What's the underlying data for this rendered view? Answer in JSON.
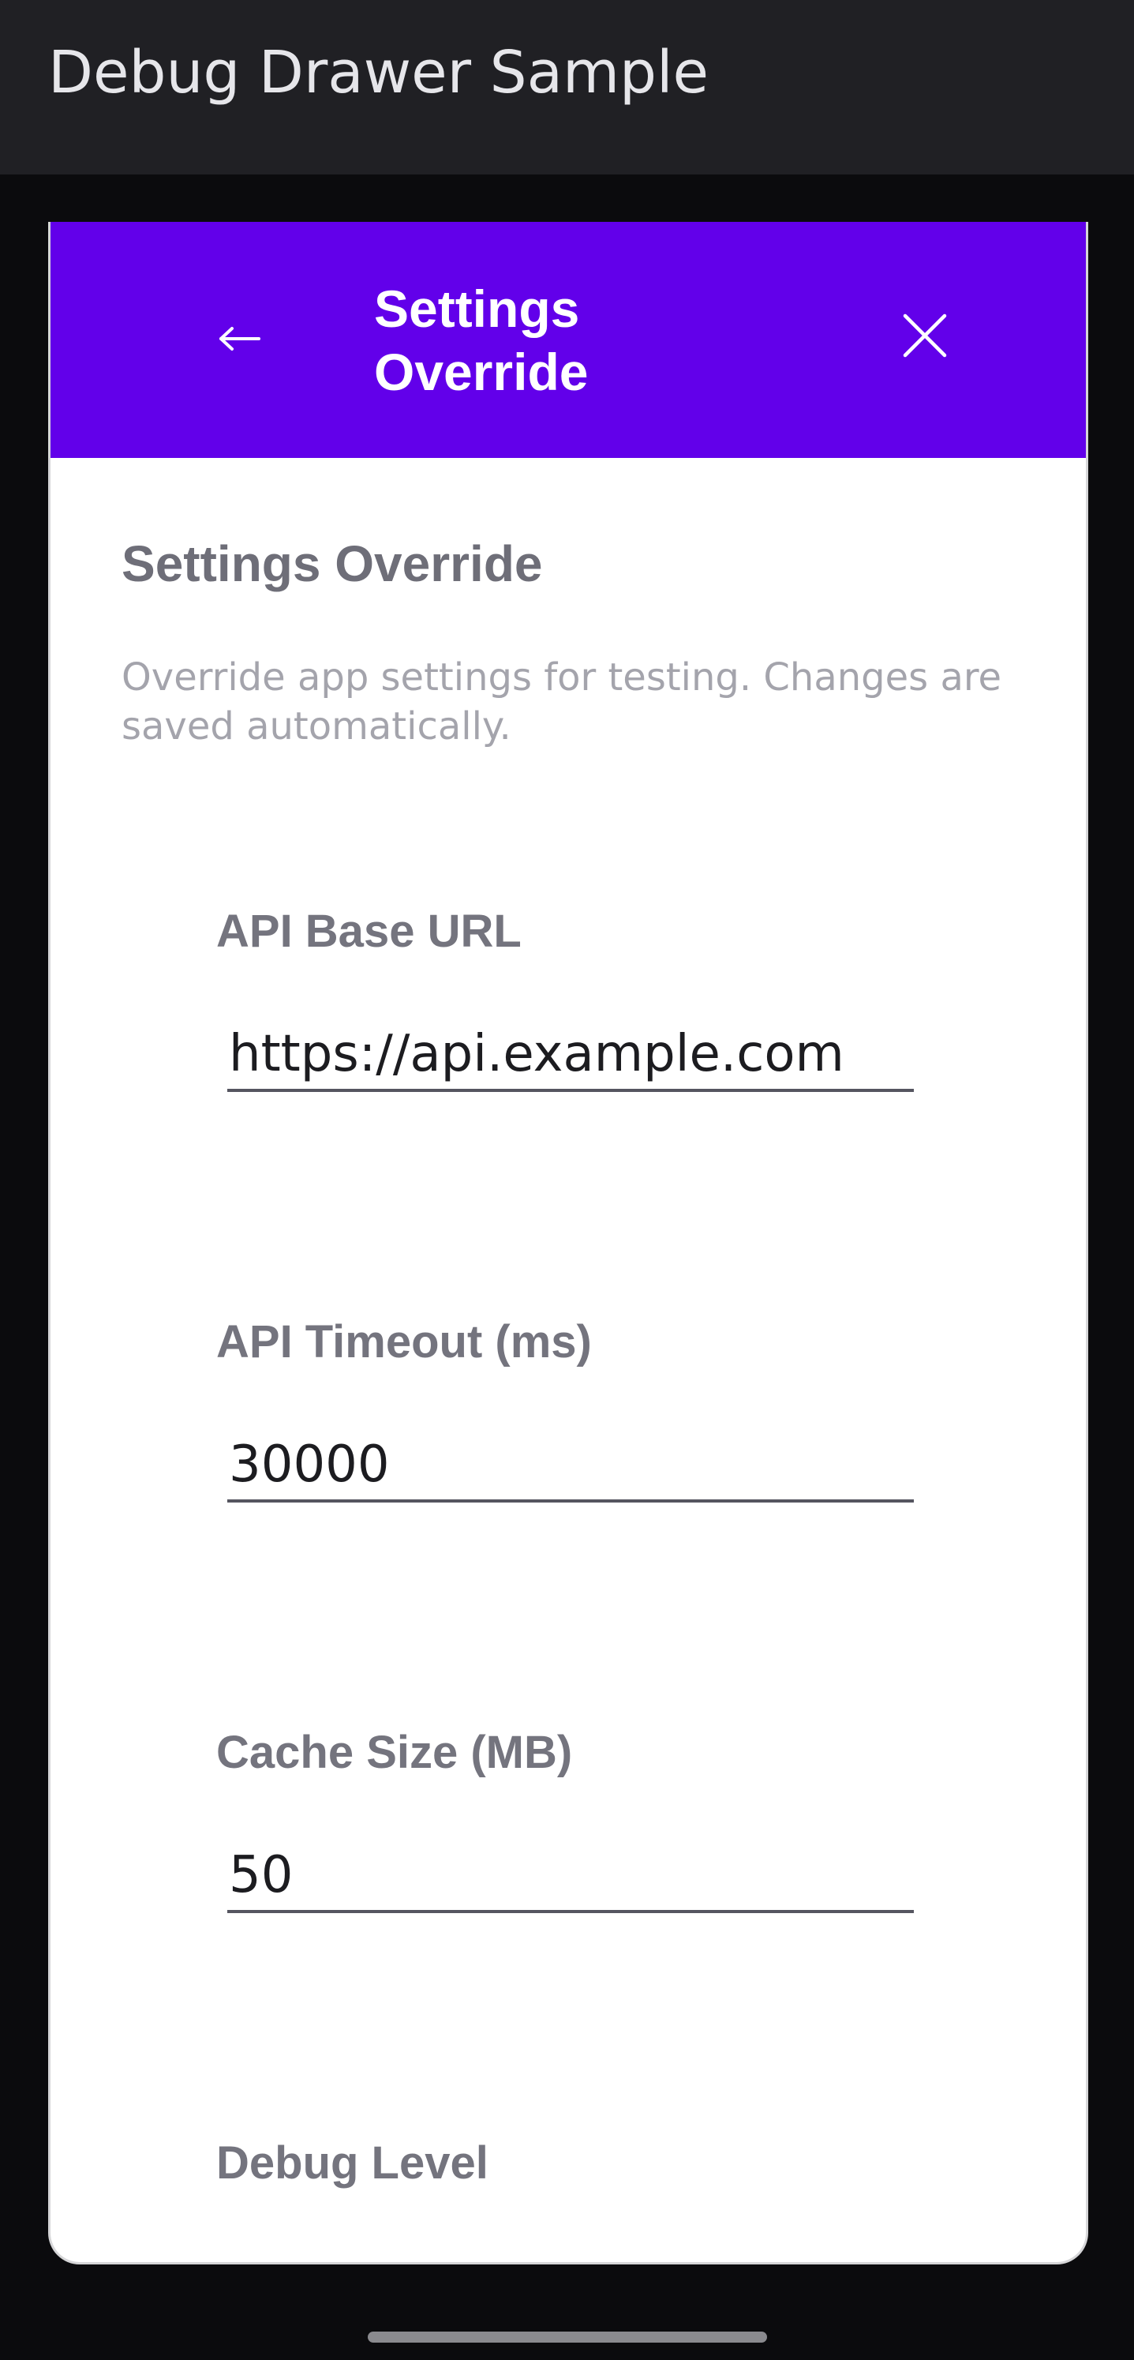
{
  "app": {
    "title": "Debug Drawer Sample"
  },
  "drawer": {
    "header": {
      "title": "Settings Override",
      "back_icon": "arrow-left-icon",
      "close_icon": "close-icon"
    },
    "section_title": "Settings Override",
    "section_description": "Override app settings for testing. Changes are saved automatically.",
    "fields": [
      {
        "label": "API Base URL",
        "value": "https://api.example.com"
      },
      {
        "label": "API Timeout (ms)",
        "value": "30000"
      },
      {
        "label": "Cache Size (MB)",
        "value": "50"
      },
      {
        "label": "Debug Level"
      }
    ]
  },
  "colors": {
    "app_bar": "#202024",
    "header_accent": "#6200ea",
    "background": "#0b0b0d",
    "card": "#ffffff"
  }
}
